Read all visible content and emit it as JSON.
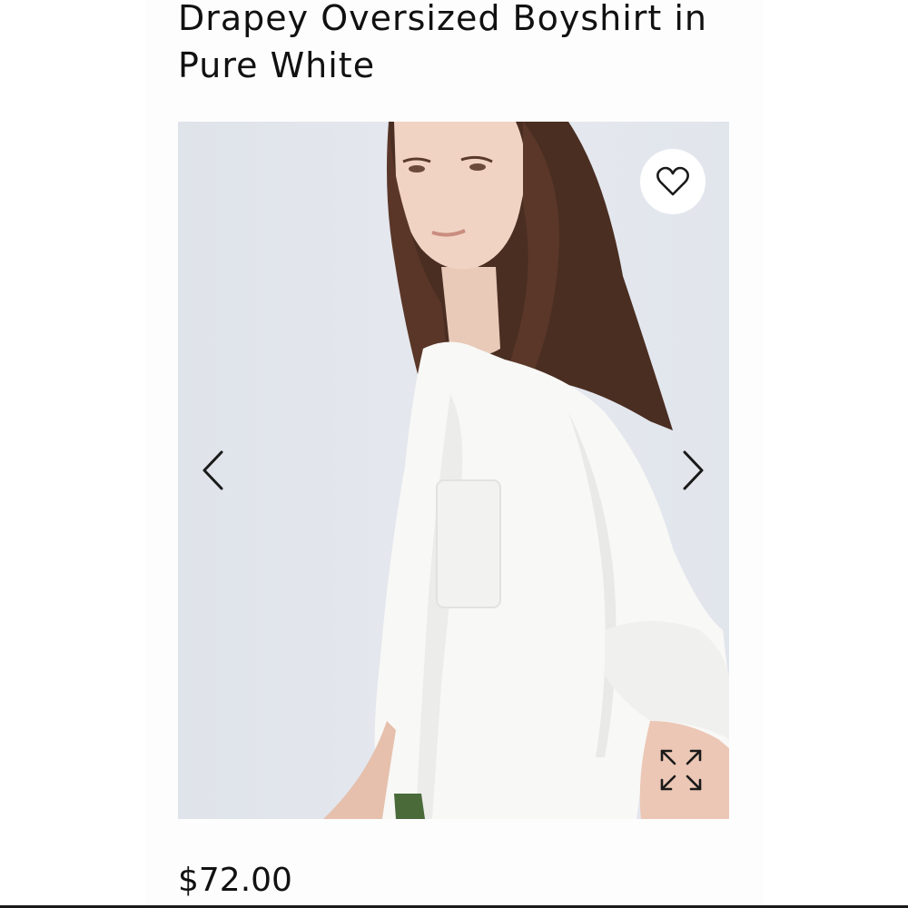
{
  "product": {
    "title": "Drapey Oversized Boyshirt in Pure White",
    "price": "$72.00"
  },
  "gallery": {
    "icons": {
      "favorite": "heart-icon",
      "previous": "chevron-left-icon",
      "next": "chevron-right-icon",
      "expand": "expand-arrows-icon"
    }
  },
  "colors": {
    "text": "#111111",
    "photo_background": "#e3e7ee"
  }
}
